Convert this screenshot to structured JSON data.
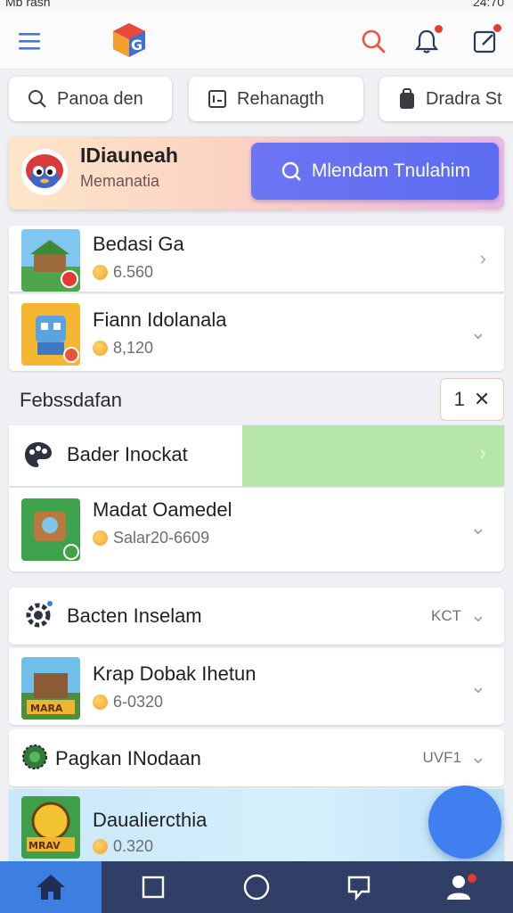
{
  "status_bar": {
    "left_text": "Mb rash",
    "right_text": "24:70"
  },
  "colors": {
    "accent": "#5b6cf0",
    "nav_bg": "#2f3f66",
    "nav_active": "#3c7fe0",
    "highlight_green": "#b6e6a8",
    "fab": "#3f7ff0"
  },
  "app_bar": {
    "icons": [
      "menu-icon",
      "app-logo",
      "search-icon",
      "bell-icon",
      "edit-icon"
    ]
  },
  "chips": [
    {
      "label": "Panoa den",
      "icon": "search-icon"
    },
    {
      "label": "Rehanagth",
      "icon": "list-icon"
    },
    {
      "label": "Dradra St",
      "icon": "bag-icon"
    }
  ],
  "promo": {
    "title": "IDiauneah",
    "subtitle": "Memanatia",
    "button_label": "Mlendam Tnulahim"
  },
  "games_top": [
    {
      "title": "Bedasi Ga",
      "meta": "6.560"
    },
    {
      "title": "Fiann Idolanala",
      "meta": "8,120"
    }
  ],
  "section": {
    "title": "Febssdafan",
    "close_count": "1",
    "close_symbol": "✕"
  },
  "rows": {
    "bader": {
      "title": "Bader Inockat"
    },
    "madat": {
      "title": "Madat Oamedel",
      "meta": "Salar20-6609"
    },
    "bacten": {
      "title": "Bacten Inselam",
      "tag": "KCT"
    },
    "krap": {
      "title": "Krap Dobak Ihetun",
      "meta": "6-0320"
    },
    "pagkan": {
      "title": "Pagkan INodaan",
      "tag": "UVF1"
    },
    "daualler": {
      "title": "Daualiercthia",
      "meta": "0.320"
    }
  },
  "bottom_nav": [
    "home-icon",
    "square-icon",
    "circle-icon",
    "chat-icon",
    "profile-icon"
  ]
}
